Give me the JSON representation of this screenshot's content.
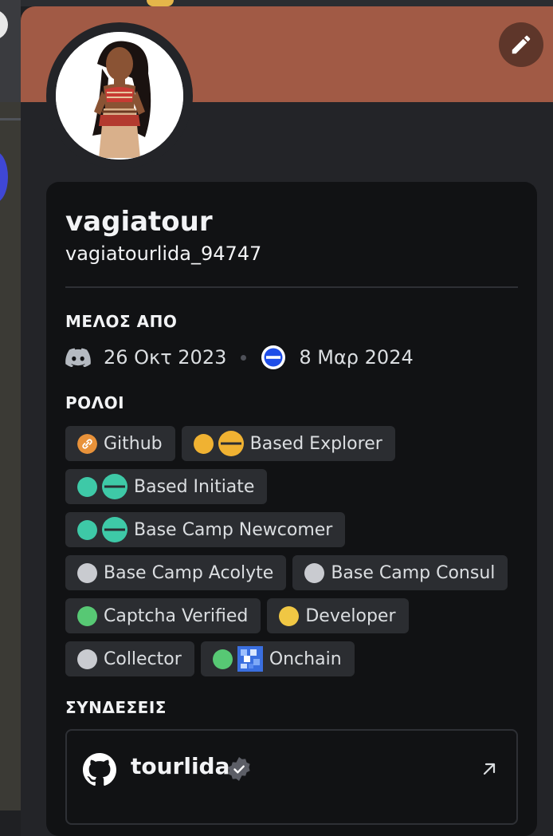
{
  "profile": {
    "display_name": "vagiatour",
    "username": "vagiatourlida_94747",
    "banner_color": "#a15a45",
    "avatar_icon": "avatar-portrait"
  },
  "member_since": {
    "title": "ΜΕΛΟΣ ΑΠΟ",
    "discord_date": "26 Οκτ 2023",
    "server_date": "8 Μαρ 2024",
    "discord_icon": "discord-logo-icon",
    "server_icon": "base-server-icon"
  },
  "roles": {
    "title": "ΡΟΛΟΙ",
    "items": [
      {
        "label": "Github",
        "color": "#e8923a",
        "icon": "link-icon"
      },
      {
        "label": "Based Explorer",
        "color": "#f0b232",
        "icon": "base-logo-icon"
      },
      {
        "label": "Based Initiate",
        "color": "#3ec9a7",
        "icon": "base-logo-icon"
      },
      {
        "label": "Base Camp Newcomer",
        "color": "#3ec9a7",
        "icon": "base-logo-icon"
      },
      {
        "label": "Base Camp Acolyte",
        "color": "#c9cbd0"
      },
      {
        "label": "Base Camp Consul",
        "color": "#c9cbd0"
      },
      {
        "label": "Captcha Verified",
        "color": "#57c874"
      },
      {
        "label": "Developer",
        "color": "#f0c744"
      },
      {
        "label": "Collector",
        "color": "#c9cbd0"
      },
      {
        "label": "Onchain",
        "color": "#57c874",
        "icon": "onchain-pixel-icon"
      }
    ]
  },
  "connections": {
    "title": "ΣΥΝΔΕΣΕΙΣ",
    "items": [
      {
        "service": "github",
        "name": "tourlida",
        "icon": "github-icon",
        "verified": true
      }
    ]
  }
}
